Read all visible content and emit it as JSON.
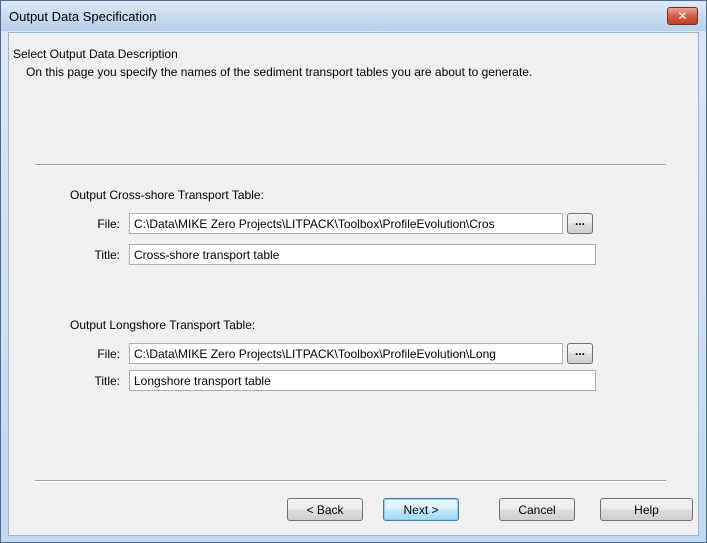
{
  "window": {
    "title": "Output Data Specification",
    "close_glyph": "✕"
  },
  "page": {
    "heading": "Select Output Data Description",
    "description": "On this page you specify the names of the sediment transport tables you are about to generate."
  },
  "cross_shore": {
    "section_label": "Output Cross-shore Transport Table:",
    "file_label": "File:",
    "file_value": "C:\\Data\\MIKE Zero Projects\\LITPACK\\Toolbox\\ProfileEvolution\\Cros",
    "browse_label": "...",
    "title_label": "Title:",
    "title_value": "Cross-shore transport table"
  },
  "longshore": {
    "section_label": "Output Longshore Transport Table:",
    "file_label": "File:",
    "file_value": "C:\\Data\\MIKE Zero Projects\\LITPACK\\Toolbox\\ProfileEvolution\\Long",
    "browse_label": "...",
    "title_label": "Title:",
    "title_value": "Longshore transport table"
  },
  "buttons": {
    "back": "< Back",
    "next": "Next >",
    "cancel": "Cancel",
    "help": "Help"
  }
}
